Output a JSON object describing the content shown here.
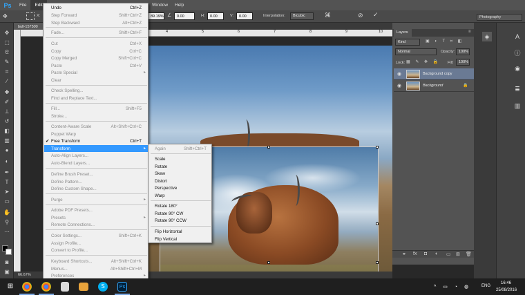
{
  "app": {
    "logo": "Ps"
  },
  "menubar": {
    "items": [
      "File",
      "Edit",
      "Window",
      "Help"
    ]
  },
  "options": {
    "ref_point_label": "X:",
    "w_value": "89.19%",
    "angle_value": "0.00",
    "h_label": "H:",
    "h_value": "0.00",
    "v_label": "V:",
    "v_value": "0.00",
    "interpolation_label": "Interpolation:",
    "interpolation_value": "Bicubic"
  },
  "document": {
    "tab_label": "bull-157500",
    "zoom": "66.67%",
    "ruler_ticks": [
      "3",
      "4",
      "5",
      "6",
      "7",
      "8",
      "9",
      "10"
    ]
  },
  "edit_menu": {
    "items": [
      {
        "label": "Undo",
        "shortcut": "Ctrl+Z",
        "disabled": false
      },
      {
        "label": "Step Forward",
        "shortcut": "Shift+Ctrl+Z",
        "disabled": true
      },
      {
        "label": "Step Backward",
        "shortcut": "Alt+Ctrl+Z",
        "disabled": true
      },
      {
        "label": "Fade...",
        "shortcut": "Shift+Ctrl+F",
        "disabled": true
      },
      {
        "label": "Cut",
        "shortcut": "Ctrl+X",
        "disabled": true
      },
      {
        "label": "Copy",
        "shortcut": "Ctrl+C",
        "disabled": true
      },
      {
        "label": "Copy Merged",
        "shortcut": "Shift+Ctrl+C",
        "disabled": true
      },
      {
        "label": "Paste",
        "shortcut": "Ctrl+V",
        "disabled": true
      },
      {
        "label": "Paste Special",
        "shortcut": "",
        "disabled": true,
        "submenu": true
      },
      {
        "label": "Clear",
        "shortcut": "",
        "disabled": true
      },
      {
        "label": "Check Spelling...",
        "shortcut": "",
        "disabled": true
      },
      {
        "label": "Find and Replace Text...",
        "shortcut": "",
        "disabled": true
      },
      {
        "label": "Fill...",
        "shortcut": "Shift+F5",
        "disabled": true
      },
      {
        "label": "Stroke...",
        "shortcut": "",
        "disabled": true
      },
      {
        "label": "Content-Aware Scale",
        "shortcut": "Alt+Shift+Ctrl+C",
        "disabled": true
      },
      {
        "label": "Puppet Warp",
        "shortcut": "",
        "disabled": true
      },
      {
        "label": "Free Transform",
        "shortcut": "Ctrl+T",
        "disabled": false,
        "checked": true
      },
      {
        "label": "Transform",
        "shortcut": "",
        "disabled": false,
        "submenu": true,
        "highlighted": true
      },
      {
        "label": "Auto-Align Layers...",
        "shortcut": "",
        "disabled": true
      },
      {
        "label": "Auto-Blend Layers...",
        "shortcut": "",
        "disabled": true
      },
      {
        "label": "Define Brush Preset...",
        "shortcut": "",
        "disabled": true
      },
      {
        "label": "Define Pattern...",
        "shortcut": "",
        "disabled": true
      },
      {
        "label": "Define Custom Shape...",
        "shortcut": "",
        "disabled": true
      },
      {
        "label": "Purge",
        "shortcut": "",
        "disabled": true,
        "submenu": true
      },
      {
        "label": "Adobe PDF Presets...",
        "shortcut": "",
        "disabled": true
      },
      {
        "label": "Presets",
        "shortcut": "",
        "disabled": true,
        "submenu": true
      },
      {
        "label": "Remote Connections...",
        "shortcut": "",
        "disabled": true
      },
      {
        "label": "Color Settings...",
        "shortcut": "Shift+Ctrl+K",
        "disabled": true
      },
      {
        "label": "Assign Profile...",
        "shortcut": "",
        "disabled": true
      },
      {
        "label": "Convert to Profile...",
        "shortcut": "",
        "disabled": true
      },
      {
        "label": "Keyboard Shortcuts...",
        "shortcut": "Alt+Shift+Ctrl+K",
        "disabled": true
      },
      {
        "label": "Menus...",
        "shortcut": "Alt+Shift+Ctrl+M",
        "disabled": true
      },
      {
        "label": "Preferences",
        "shortcut": "",
        "disabled": true,
        "submenu": true
      }
    ]
  },
  "transform_menu": {
    "items": [
      {
        "label": "Again",
        "shortcut": "Shift+Ctrl+T",
        "disabled": true
      },
      {
        "label": "Scale",
        "shortcut": ""
      },
      {
        "label": "Rotate",
        "shortcut": ""
      },
      {
        "label": "Skew",
        "shortcut": ""
      },
      {
        "label": "Distort",
        "shortcut": ""
      },
      {
        "label": "Perspective",
        "shortcut": ""
      },
      {
        "label": "Warp",
        "shortcut": ""
      },
      {
        "label": "Rotate 180°",
        "shortcut": ""
      },
      {
        "label": "Rotate 90° CW",
        "shortcut": ""
      },
      {
        "label": "Rotate 90° CCW",
        "shortcut": ""
      },
      {
        "label": "Flip Horizontal",
        "shortcut": ""
      },
      {
        "label": "Flip Vertical",
        "shortcut": ""
      }
    ]
  },
  "layers": {
    "tab_label": "Layers",
    "kind_label": "Kind",
    "blend_mode": "Normal",
    "opacity_label": "Opacity:",
    "opacity_value": "100%",
    "lock_label": "Lock:",
    "fill_label": "Fill:",
    "fill_value": "100%",
    "items": [
      {
        "name": "Background copy",
        "selected": true
      },
      {
        "name": "Background",
        "selected": false,
        "locked": true
      }
    ]
  },
  "workspace": {
    "label": "Photography"
  },
  "taskbar": {
    "lang": "ENG",
    "time": "16:46",
    "date": "25/08/2016"
  },
  "colors": {
    "accent": "#3399ff",
    "ps_blue": "#31a8ff",
    "panel": "#535353"
  }
}
